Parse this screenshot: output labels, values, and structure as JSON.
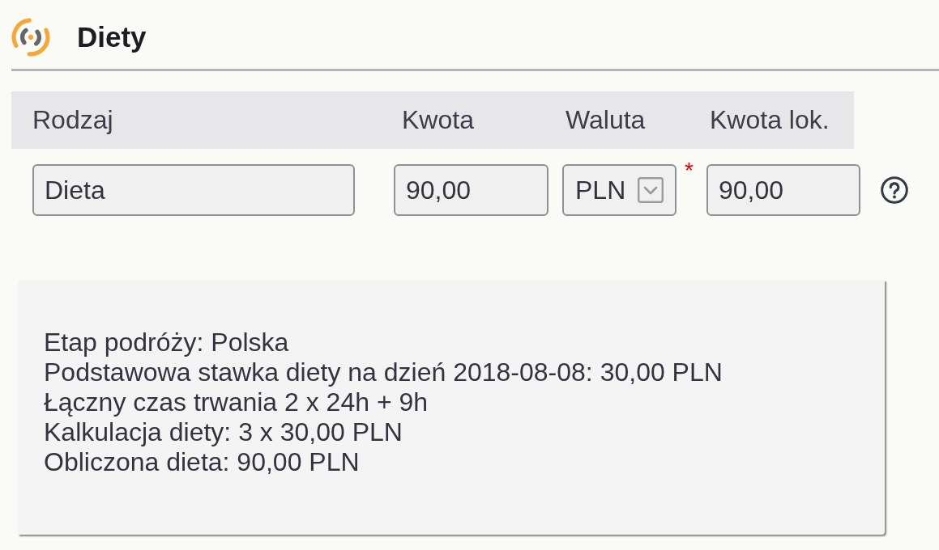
{
  "header": {
    "title": "Diety"
  },
  "table": {
    "columns": [
      "Rodzaj",
      "Kwota",
      "Waluta",
      "Kwota lok."
    ],
    "rows": [
      {
        "type": "Dieta",
        "amount": "90,00",
        "currency": "PLN",
        "required_mark": "*",
        "local_amount": "90,00"
      }
    ]
  },
  "info_panel": {
    "lines": [
      "Etap podróży: Polska",
      "Podstawowa stawka diety na dzień 2018-08-08: 30,00 PLN",
      "Łączny czas trwania 2 x 24h + 9h",
      "Kalkulacja diety: 3 x 30,00 PLN",
      "Obliczona dieta: 90,00 PLN"
    ]
  }
}
